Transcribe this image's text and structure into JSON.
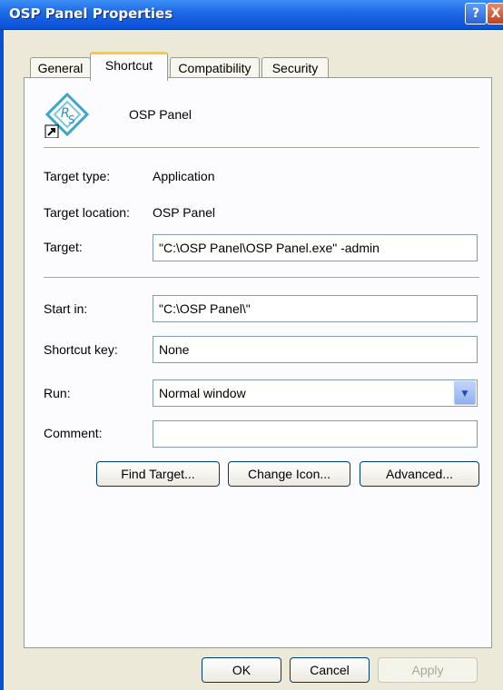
{
  "window": {
    "title": "OSP Panel Properties",
    "help_label": "?",
    "close_label": "X"
  },
  "tabs": [
    {
      "label": "General",
      "active": false
    },
    {
      "label": "Shortcut",
      "active": true
    },
    {
      "label": "Compatibility",
      "active": false
    },
    {
      "label": "Security",
      "active": false
    }
  ],
  "app": {
    "name": "OSP Panel",
    "icon": "osp-panel-shortcut-icon"
  },
  "info": {
    "target_type_label": "Target type:",
    "target_type_value": "Application",
    "target_location_label": "Target location:",
    "target_location_value": "OSP Panel"
  },
  "fields": {
    "target_label": "Target:",
    "target_value": "\"C:\\OSP Panel\\OSP Panel.exe\" -admin",
    "start_in_label": "Start in:",
    "start_in_value": "\"C:\\OSP Panel\\\"",
    "shortcut_key_label": "Shortcut key:",
    "shortcut_key_value": "None",
    "run_label": "Run:",
    "run_value": "Normal window",
    "comment_label": "Comment:",
    "comment_value": ""
  },
  "buttons": {
    "find_target": "Find Target...",
    "change_icon": "Change Icon...",
    "advanced": "Advanced...",
    "ok": "OK",
    "cancel": "Cancel",
    "apply": "Apply"
  },
  "colors": {
    "title_bar": "#0a4fd7",
    "active_tab_highlight": "#ffc83c",
    "dialog_bg": "#ece9d8"
  }
}
